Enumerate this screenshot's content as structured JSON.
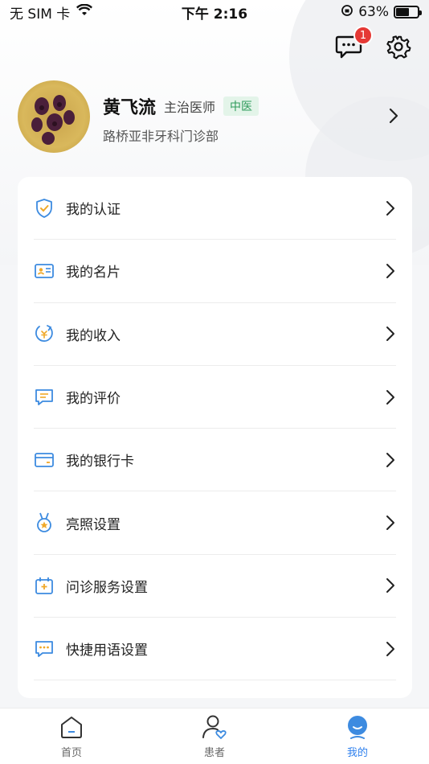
{
  "status_bar": {
    "carrier": "无 SIM 卡",
    "time": "下午 2:16",
    "battery": "63%",
    "battery_level": 0.63
  },
  "header": {
    "message_badge": "1"
  },
  "profile": {
    "name": "黄飞流",
    "title": "主治医师",
    "tag": "中医",
    "clinic": "路桥亚非牙科门诊部"
  },
  "menu": {
    "items": [
      {
        "label": "我的认证",
        "icon": "shield-check-icon"
      },
      {
        "label": "我的名片",
        "icon": "id-card-icon"
      },
      {
        "label": "我的收入",
        "icon": "income-icon"
      },
      {
        "label": "我的评价",
        "icon": "comment-icon"
      },
      {
        "label": "我的银行卡",
        "icon": "bank-card-icon"
      },
      {
        "label": "亮照设置",
        "icon": "medal-icon"
      },
      {
        "label": "问诊服务设置",
        "icon": "consult-service-icon"
      },
      {
        "label": "快捷用语设置",
        "icon": "quick-phrase-icon"
      }
    ]
  },
  "tab_bar": {
    "tabs": [
      {
        "label": "首页",
        "icon": "home-icon"
      },
      {
        "label": "患者",
        "icon": "patient-icon"
      },
      {
        "label": "我的",
        "icon": "me-icon"
      }
    ],
    "active_index": 2
  },
  "colors": {
    "accent": "#2f80ed",
    "badge": "#e53935",
    "tag_text": "#2e9a5a"
  }
}
